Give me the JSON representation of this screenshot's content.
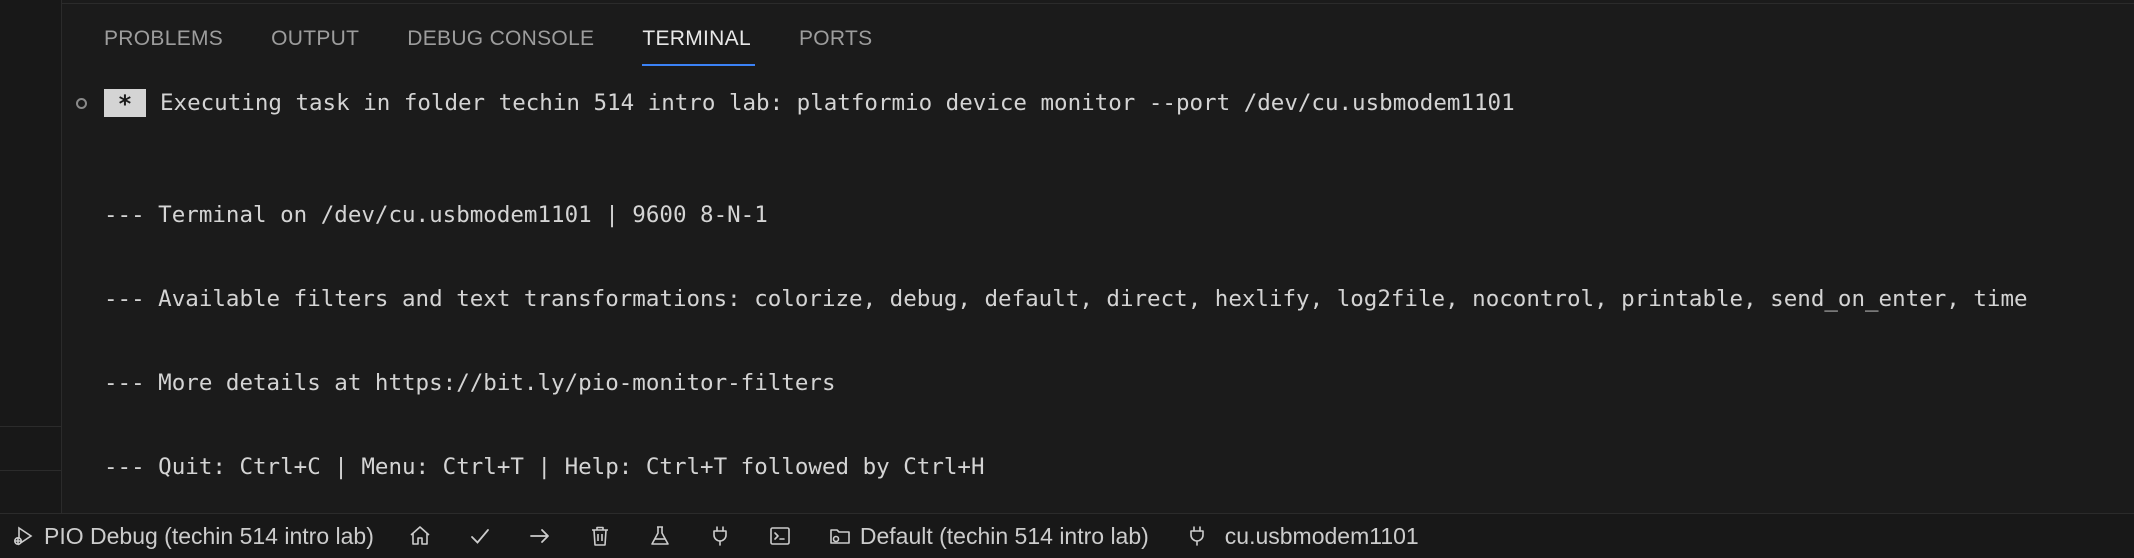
{
  "panel": {
    "tabs": [
      {
        "label": "PROBLEMS",
        "active": false
      },
      {
        "label": "OUTPUT",
        "active": false
      },
      {
        "label": "DEBUG CONSOLE",
        "active": false
      },
      {
        "label": "TERMINAL",
        "active": true
      },
      {
        "label": "PORTS",
        "active": false
      }
    ]
  },
  "terminal": {
    "task_marker": "*",
    "task_line": "Executing task in folder techin 514 intro lab: platformio device monitor --port /dev/cu.usbmodem1101",
    "lines": [
      "--- Terminal on /dev/cu.usbmodem1101 | 9600 8-N-1",
      "--- Available filters and text transformations: colorize, debug, default, direct, hexlify, log2file, nocontrol, printable, send_on_enter, time",
      "--- More details at https://bit.ly/pio-monitor-filters",
      "--- Quit: Ctrl+C | Menu: Ctrl+T | Help: Ctrl+T followed by Ctrl+H"
    ]
  },
  "statusbar": {
    "debug_label": "PIO Debug (techin 514 intro lab)",
    "icons": [
      "home-icon",
      "check-icon",
      "arrow-right-icon",
      "trash-icon",
      "flask-icon",
      "plug-icon",
      "terminal-icon"
    ],
    "env_label": "Default (techin 514 intro lab)",
    "port_label": "cu.usbmodem1101"
  },
  "colors": {
    "background": "#1b1b1b",
    "active_tab_underline": "#3b82f6",
    "text": "#d4d4d4"
  }
}
